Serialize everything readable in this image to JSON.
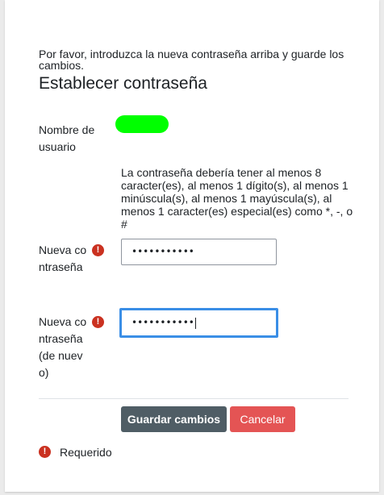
{
  "form": {
    "intro": "Por favor, introduzca la nueva contraseña arriba y guarde los cambios.",
    "title": "Establecer contraseña",
    "username_label": "Nombre de usuario",
    "username_value": "",
    "policy_text": "La contraseña debería tener al menos 8 caracter(es), al menos 1 dígito(s), al menos 1 minúscula(s), al menos 1 mayúscula(s), al menos 1 caracter(es) especial(es) como *, -, o #",
    "new_password_label": "Nueva contraseña",
    "new_password_value": "•••••••••••",
    "new_password_again_label": "Nueva contraseña (de nuevo)",
    "new_password_again_value": "•••••••••••",
    "required_icon": "exclamation-circle-icon"
  },
  "buttons": {
    "save_label": "Guardar cambios",
    "cancel_label": "Cancelar"
  },
  "legend": {
    "required_label": "Requerido"
  },
  "colors": {
    "username_highlight": "#00ff00",
    "required_icon": "#ca3120",
    "save_button": "#4f5d65",
    "cancel_button": "#e45454",
    "focus_border": "#3a8ee6"
  }
}
